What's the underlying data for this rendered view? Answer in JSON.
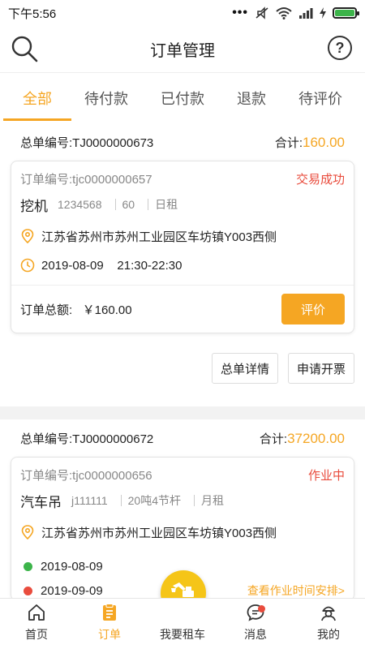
{
  "statusbar": {
    "time": "下午5:56",
    "dots": "•••"
  },
  "header": {
    "title": "订单管理",
    "help_glyph": "?"
  },
  "tabs": [
    {
      "label": "全部",
      "active": true
    },
    {
      "label": "待付款"
    },
    {
      "label": "已付款"
    },
    {
      "label": "退款"
    },
    {
      "label": "待评价"
    }
  ],
  "orders": [
    {
      "master_no": "总单编号:TJ0000000673",
      "total_label": "合计:",
      "total_value": "160.00",
      "order_no": "订单编号:tjc0000000657",
      "status": "交易成功",
      "item_name": "挖机",
      "meta": [
        "1234568",
        "60",
        "日租"
      ],
      "address": "江苏省苏州市苏州工业园区车坊镇Y003西侧",
      "datetime": "2019-08-09    21:30-22:30",
      "amount_text": "订单总额:   ￥160.00",
      "rate_button": "评价",
      "detail_button": "总单详情",
      "invoice_button": "申请开票"
    },
    {
      "master_no": "总单编号:TJ0000000672",
      "total_label": "合计:",
      "total_value": "37200.00",
      "order_no": "订单编号:tjc0000000656",
      "status": "作业中",
      "item_name": "汽车吊",
      "meta": [
        "j111111",
        "20吨4节杆",
        "月租"
      ],
      "address": "江苏省苏州市苏州工业园区车坊镇Y003西侧",
      "start_date": "2019-08-09",
      "end_date": "2019-09-09",
      "schedule_link": "查看作业时间安排>"
    }
  ],
  "tabbar": [
    {
      "label": "首页",
      "icon": "home-icon"
    },
    {
      "label": "订单",
      "icon": "order-icon",
      "active": true
    },
    {
      "label": "我要租车",
      "icon": "excavator-icon"
    },
    {
      "label": "消息",
      "icon": "message-icon"
    },
    {
      "label": "我的",
      "icon": "profile-icon"
    }
  ],
  "colors": {
    "accent": "#f5a623",
    "status_red": "#e94c3d",
    "start_dot": "#3cb44a",
    "end_dot": "#e94c3d"
  }
}
